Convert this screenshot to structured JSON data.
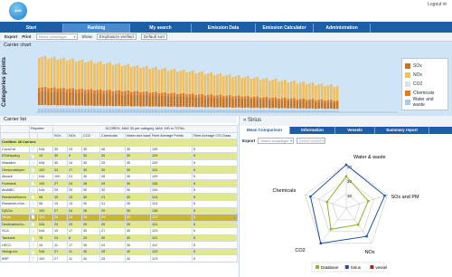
{
  "app": {
    "logo_text": "sellr",
    "logout": "Logout ✉"
  },
  "tabs": [
    {
      "label": "Start"
    },
    {
      "label": "Ranking",
      "active": true
    },
    {
      "label": "My search"
    },
    {
      "label": "Emission Data"
    },
    {
      "label": "Emission Calculator"
    },
    {
      "label": "Administration"
    }
  ],
  "toolbar": {
    "export": "Export",
    "print": "Print",
    "vessel_placeholder": "Select vesseltype",
    "show": "Show",
    "emphasize": "Emphasize verified",
    "default_sort": "Default sort"
  },
  "chart_panel": {
    "title": "Carrier chart"
  },
  "chart_data": {
    "type": "bar",
    "ylabel": "Categories points",
    "series": [
      {
        "name": "SOx",
        "color": "#c8741e"
      },
      {
        "name": "NOx",
        "color": "#f0c060"
      },
      {
        "name": "CO2",
        "color": "#d9e1ea"
      },
      {
        "name": "Chemicals",
        "color": "#e87a1e"
      },
      {
        "name": "Water and waste",
        "color": "#aac9e8"
      }
    ]
  },
  "carrier_list": {
    "title": "Carrier list",
    "headers": [
      "Reporter",
      "",
      "SOx",
      "NOx",
      "CO2",
      "Chemicals",
      "Water and waste",
      "Fleet Average Points",
      "Fleet Average CSI Class"
    ],
    "scores_caption": "SCORES, MAX 30 per category, MAX 150 in TOTAL",
    "certified": "Certified: 28 Carriers",
    "rows": [
      {
        "name": "CocoCar",
        "v": [
          "N/A",
          "30",
          "23",
          "30",
          "26",
          "30",
          "139",
          "5"
        ]
      },
      {
        "name": "EGshipping",
        "v": [
          "13",
          "30",
          "9",
          "30",
          "30",
          "30",
          "129",
          "5"
        ]
      },
      {
        "name": "Wasaline",
        "v": [
          "N/A",
          "30",
          "14",
          "30",
          "25",
          "30",
          "129",
          "5"
        ]
      },
      {
        "name": "Oresundslinjen",
        "v": [
          "100",
          "24",
          "17",
          "30",
          "30",
          "30",
          "131",
          "5"
        ]
      },
      {
        "name": "Akvark",
        "v": [
          "N/A",
          "100",
          "21",
          "30",
          "28",
          "30",
          "129",
          "5"
        ]
      },
      {
        "name": "Funktank",
        "v": [
          "100",
          "27",
          "24",
          "28",
          "29",
          "30",
          "138",
          "5"
        ]
      },
      {
        "name": "AlniBBC",
        "v": [
          "N/A",
          "25",
          "29",
          "30",
          "30",
          "30",
          "134",
          "5"
        ]
      },
      {
        "name": "ReederleBraren",
        "v": [
          "58",
          "19",
          "13",
          "30",
          "21",
          "30",
          "113",
          "5"
        ]
      },
      {
        "name": "ReederleLehm...",
        "v": [
          "58",
          "19",
          "13",
          "30",
          "21",
          "30",
          "113",
          "5"
        ]
      },
      {
        "name": "DjGOa",
        "v": [
          "100",
          "27",
          "24",
          "28",
          "29",
          "30",
          "138",
          "5"
        ]
      },
      {
        "name": "Sirius",
        "v": [
          "100",
          "26",
          "24",
          "28",
          "29",
          "30",
          "137",
          "5"
        ]
      },
      {
        "name": "DestinationGo...",
        "v": [
          "N/A",
          "23",
          "23",
          "30",
          "25",
          "30",
          "131",
          "5"
        ]
      },
      {
        "name": "SCA",
        "v": [
          "N/A",
          "19",
          "17",
          "30",
          "27",
          "30",
          "123",
          "5"
        ]
      },
      {
        "name": "Tarntank",
        "v": [
          "75",
          "24",
          "8",
          "29",
          "30",
          "30",
          "121",
          "5"
        ]
      },
      {
        "name": "UECC",
        "v": [
          "44",
          "11",
          "17",
          "30",
          "24",
          "30",
          "112",
          "5"
        ]
      },
      {
        "name": "VikingLine",
        "v": [
          "N/A",
          "27",
          "11",
          "30",
          "25",
          "30",
          "123",
          "5"
        ]
      },
      {
        "name": "BRP",
        "v": [
          "100",
          "27",
          "11",
          "30",
          "25",
          "30",
          "123",
          "5"
        ]
      }
    ]
  },
  "detail": {
    "title": "Sirius",
    "tabs": [
      "Mean Comparison",
      "Information",
      "Vessels",
      "Summary report"
    ],
    "export": "Export",
    "vessel_placeholder": "Select vesseltype",
    "vessel_placeholder2": "Select vessel",
    "radar": {
      "axes": [
        "Water & waste",
        "SOx and PM",
        "NOx",
        "CO2",
        "Chemicals"
      ],
      "ticks": [
        "30",
        "20",
        "10"
      ],
      "series": [
        {
          "name": "Database",
          "color": "#8ab52a",
          "values": [
            22,
            16,
            14,
            18,
            14
          ]
        },
        {
          "name": "Sirius",
          "color": "#1d4fa0",
          "values": [
            30,
            28,
            24,
            30,
            26
          ]
        },
        {
          "name": "vessel",
          "color": "#b22222",
          "values": []
        }
      ]
    }
  }
}
